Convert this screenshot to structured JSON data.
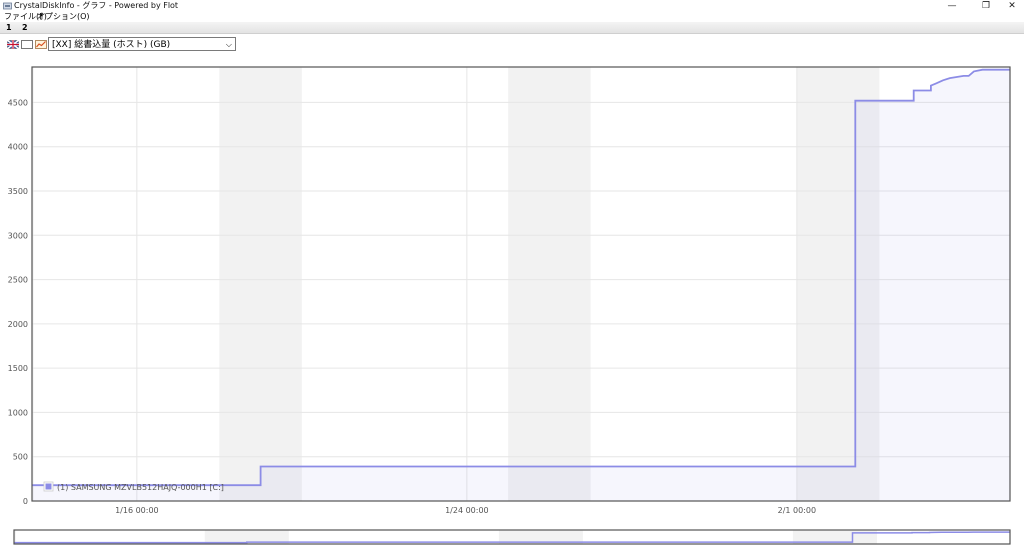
{
  "window": {
    "title": "CrystalDiskInfo - グラフ - Powered by Flot",
    "minimize_glyph": "—",
    "restore_glyph": "❐",
    "close_glyph": "✕"
  },
  "menu": {
    "items": [
      {
        "label": "ファイル(F)"
      },
      {
        "label": "オプション(O)"
      }
    ]
  },
  "tabs": [
    {
      "label": "1"
    },
    {
      "label": "2"
    }
  ],
  "toolbar": {
    "icons": [
      "flag-icon",
      "blank-icon",
      "chart-icon"
    ],
    "selected_attribute": "[XX] 総書込量 (ホスト) (GB)"
  },
  "colors": {
    "series": "#8c8ce6",
    "grid": "#e6e6e6",
    "weekend_band": "#f2f2f2",
    "plot_border": "#545454"
  },
  "chart_data": {
    "type": "line",
    "title": "",
    "xlabel": "",
    "ylabel": "",
    "x_axis": "date",
    "xlim": [
      "2025-01-13 11:00",
      "2025-02-06 04:00"
    ],
    "ylim": [
      0,
      4900
    ],
    "y_ticks": [
      0,
      500,
      1000,
      1500,
      2000,
      2500,
      3000,
      3500,
      4000,
      4500
    ],
    "x_ticks": [
      {
        "value": "2025-01-16 00:00",
        "label": "1/16 00:00"
      },
      {
        "value": "2025-01-24 00:00",
        "label": "1/24 00:00"
      },
      {
        "value": "2025-02-01 00:00",
        "label": "2/1 00:00"
      }
    ],
    "weekend_bands": [
      [
        "2025-01-13 11:00",
        "2025-01-13 12:00"
      ],
      [
        "2025-01-18 00:00",
        "2025-01-20 00:00"
      ],
      [
        "2025-01-25 00:00",
        "2025-01-27 00:00"
      ],
      [
        "2025-02-01 00:00",
        "2025-02-03 00:00"
      ]
    ],
    "grid": true,
    "legend_position": "bottom-left",
    "series": [
      {
        "name": "(1) SAMSUNG MZVLB512HAJQ-000H1 [C:]",
        "step": true,
        "points": [
          [
            "2025-01-13 11:00",
            178
          ],
          [
            "2025-01-19 00:00",
            178
          ],
          [
            "2025-01-19 00:00",
            390
          ],
          [
            "2025-02-02 10:00",
            390
          ],
          [
            "2025-02-02 10:00",
            4520
          ],
          [
            "2025-02-03 20:00",
            4520
          ],
          [
            "2025-02-03 20:00",
            4635
          ],
          [
            "2025-02-04 06:00",
            4635
          ],
          [
            "2025-02-04 06:00",
            4690
          ],
          [
            "2025-02-04 09:00",
            4715
          ],
          [
            "2025-02-04 13:00",
            4750
          ],
          [
            "2025-02-04 17:00",
            4775
          ],
          [
            "2025-02-05 01:00",
            4800
          ],
          [
            "2025-02-05 04:00",
            4800
          ],
          [
            "2025-02-05 07:00",
            4850
          ],
          [
            "2025-02-05 12:00",
            4870
          ],
          [
            "2025-02-06 04:00",
            4870
          ]
        ]
      }
    ]
  }
}
